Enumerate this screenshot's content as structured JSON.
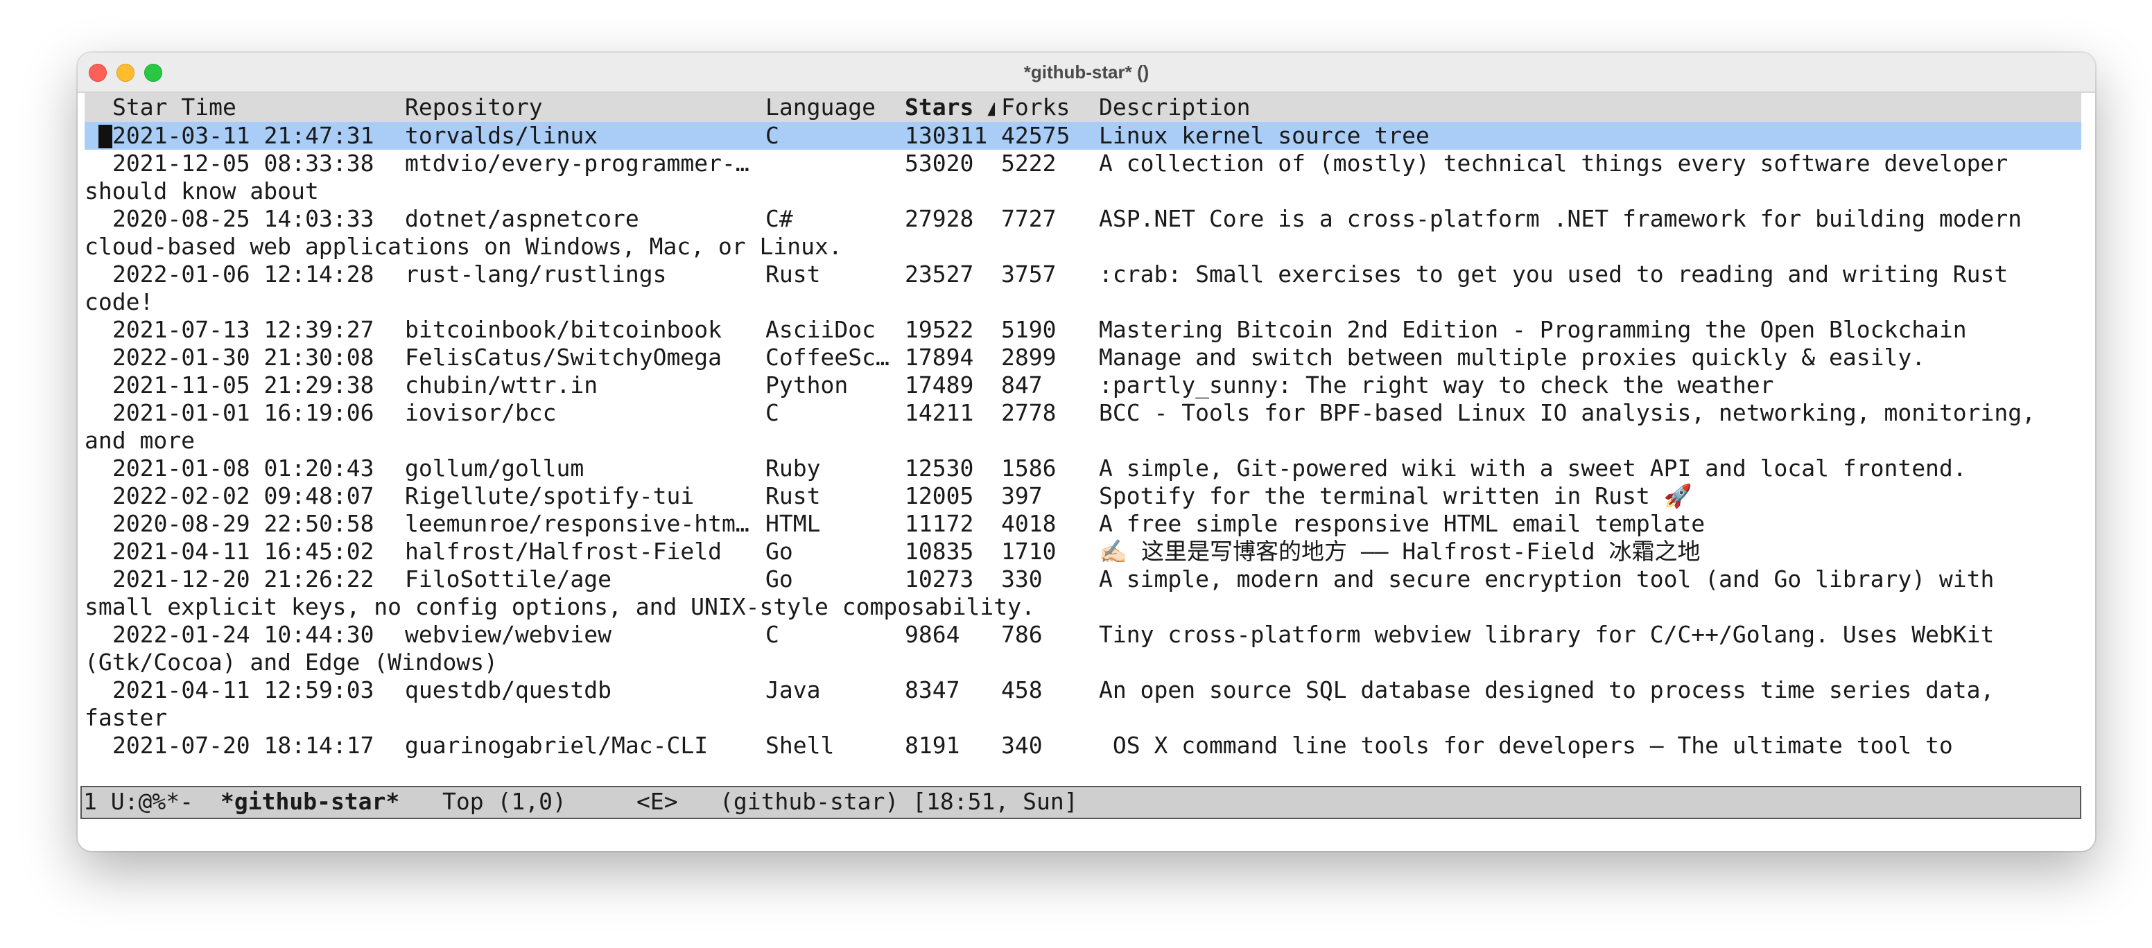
{
  "window": {
    "title": "*github-star* ()",
    "colors": {
      "selection": "#a9cdf6",
      "header_bg": "#dadada",
      "modeline_bg": "#cfcfcf"
    }
  },
  "header": {
    "star_time": "Star Time",
    "repository": "Repository",
    "language": "Language",
    "stars": "Stars ▲",
    "forks": "Forks",
    "description": "Description"
  },
  "rows": [
    {
      "time": "2021-03-11 21:47:31",
      "repo": "torvalds/linux",
      "lang": "C",
      "stars": "130311",
      "forks": "42575",
      "desc": "Linux kernel source tree",
      "wrap": ""
    },
    {
      "time": "2021-12-05 08:33:38",
      "repo": "mtdvio/every-programmer-…",
      "lang": "",
      "stars": "53020",
      "forks": "5222",
      "desc": "A collection of (mostly) technical things every software developer",
      "wrap": "should know about"
    },
    {
      "time": "2020-08-25 14:03:33",
      "repo": "dotnet/aspnetcore",
      "lang": "C#",
      "stars": "27928",
      "forks": "7727",
      "desc": "ASP.NET Core is a cross-platform .NET framework for building modern",
      "wrap": "cloud-based web applications on Windows, Mac, or Linux."
    },
    {
      "time": "2022-01-06 12:14:28",
      "repo": "rust-lang/rustlings",
      "lang": "Rust",
      "stars": "23527",
      "forks": "3757",
      "desc": ":crab: Small exercises to get you used to reading and writing Rust",
      "wrap": "code!"
    },
    {
      "time": "2021-07-13 12:39:27",
      "repo": "bitcoinbook/bitcoinbook",
      "lang": "AsciiDoc",
      "stars": "19522",
      "forks": "5190",
      "desc": "Mastering Bitcoin 2nd Edition - Programming the Open Blockchain",
      "wrap": ""
    },
    {
      "time": "2022-01-30 21:30:08",
      "repo": "FelisCatus/SwitchyOmega",
      "lang": "CoffeeSc…",
      "stars": "17894",
      "forks": "2899",
      "desc": "Manage and switch between multiple proxies quickly & easily.",
      "wrap": ""
    },
    {
      "time": "2021-11-05 21:29:38",
      "repo": "chubin/wttr.in",
      "lang": "Python",
      "stars": "17489",
      "forks": "847",
      "desc": ":partly_sunny: The right way to check the weather",
      "wrap": ""
    },
    {
      "time": "2021-01-01 16:19:06",
      "repo": "iovisor/bcc",
      "lang": "C",
      "stars": "14211",
      "forks": "2778",
      "desc": "BCC - Tools for BPF-based Linux IO analysis, networking, monitoring,",
      "wrap": "and more"
    },
    {
      "time": "2021-01-08 01:20:43",
      "repo": "gollum/gollum",
      "lang": "Ruby",
      "stars": "12530",
      "forks": "1586",
      "desc": "A simple, Git-powered wiki with a sweet API and local frontend.",
      "wrap": ""
    },
    {
      "time": "2022-02-02 09:48:07",
      "repo": "Rigellute/spotify-tui",
      "lang": "Rust",
      "stars": "12005",
      "forks": "397",
      "desc": "Spotify for the terminal written in Rust 🚀",
      "wrap": ""
    },
    {
      "time": "2020-08-29 22:50:58",
      "repo": "leemunroe/responsive-htm…",
      "lang": "HTML",
      "stars": "11172",
      "forks": "4018",
      "desc": "A free simple responsive HTML email template",
      "wrap": ""
    },
    {
      "time": "2021-04-11 16:45:02",
      "repo": "halfrost/Halfrost-Field",
      "lang": "Go",
      "stars": "10835",
      "forks": "1710",
      "desc": "✍🏻 这里是写博客的地方 —— Halfrost-Field 冰霜之地",
      "wrap": ""
    },
    {
      "time": "2021-12-20 21:26:22",
      "repo": "FiloSottile/age",
      "lang": "Go",
      "stars": "10273",
      "forks": "330",
      "desc": "A simple, modern and secure encryption tool (and Go library) with",
      "wrap": "small explicit keys, no config options, and UNIX-style composability."
    },
    {
      "time": "2022-01-24 10:44:30",
      "repo": "webview/webview",
      "lang": "C",
      "stars": "9864",
      "forks": "786",
      "desc": "Tiny cross-platform webview library for C/C++/Golang. Uses WebKit",
      "wrap": "(Gtk/Cocoa) and Edge (Windows)"
    },
    {
      "time": "2021-04-11 12:59:03",
      "repo": "questdb/questdb",
      "lang": "Java",
      "stars": "8347",
      "forks": "458",
      "desc": "An open source SQL database designed to process time series data,",
      "wrap": "faster"
    },
    {
      "time": "2021-07-20 18:14:17",
      "repo": "guarinogabriel/Mac-CLI",
      "lang": "Shell",
      "stars": "8191",
      "forks": "340",
      "desc": " OS X command line tools for developers – The ultimate tool to",
      "wrap": ""
    }
  ],
  "modeline": {
    "status": "1 U:@%*-",
    "buffer": "*github-star*",
    "position": "Top (1,0)",
    "state": "<E>",
    "mode": "(github-star) [18:51, Sun]"
  }
}
